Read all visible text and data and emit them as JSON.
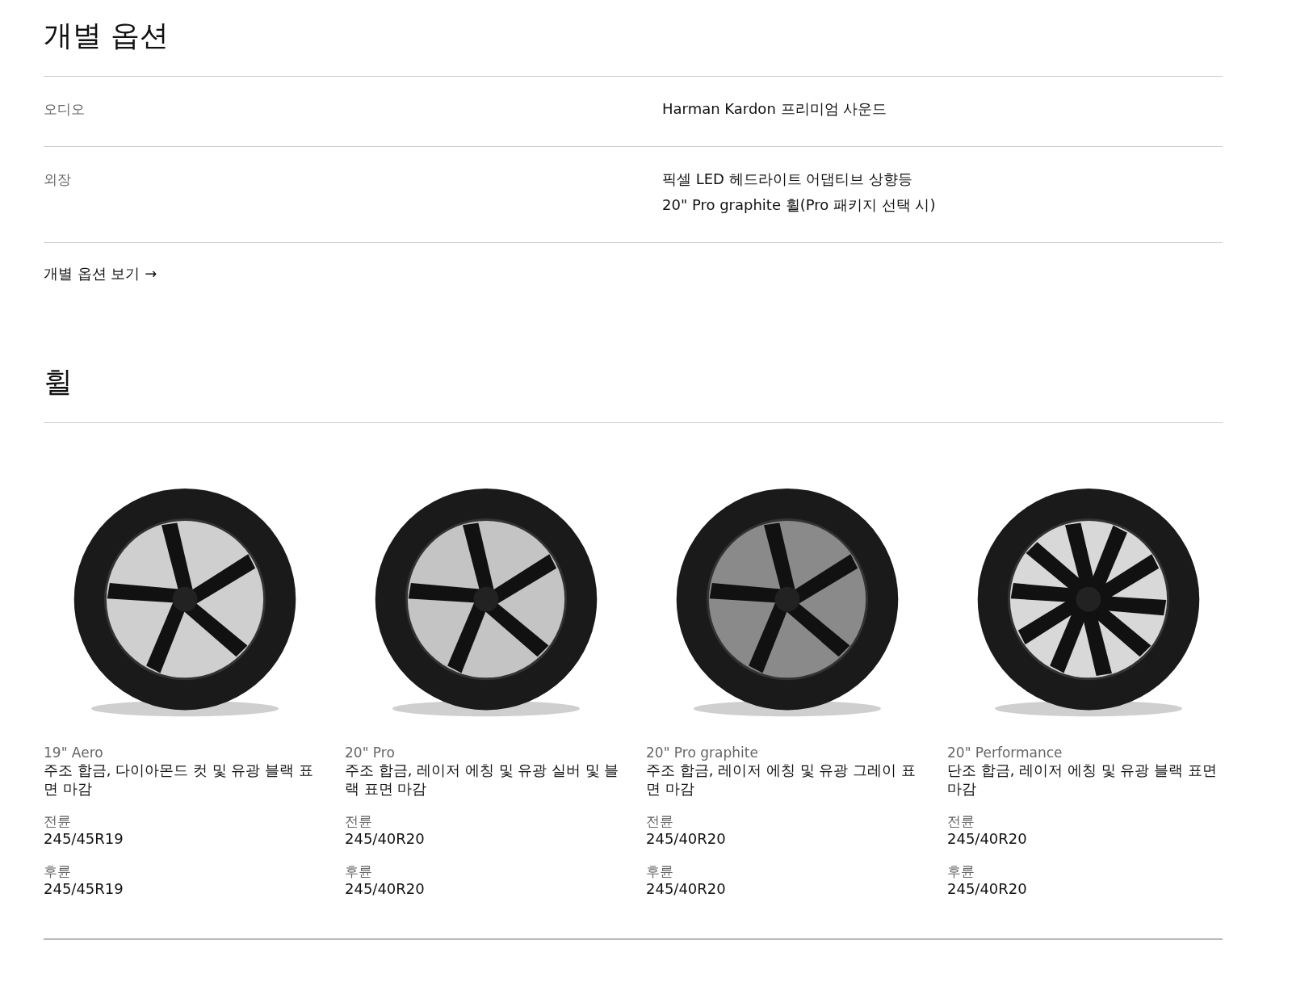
{
  "title": "개별 옵션",
  "options": [
    {
      "category": "오디오",
      "items": [
        "Harman Kardon 프리미엄 사운드"
      ]
    },
    {
      "category": "외장",
      "items": [
        "픽셀 LED 헤드라이트 어댑티브 상향등",
        "20\" Pro graphite 휠(Pro 패키지 선택 시)"
      ]
    }
  ],
  "options_link": "개별 옵션 보기 →",
  "wheels_title": "휠",
  "wheels": [
    {
      "name": "19\" Aero",
      "description": "주조 합금, 다이아몬드 컷 및 유광 블랙 표면 마감",
      "front_label": "전륜",
      "front": "245/45R19",
      "rear_label": "후륜",
      "rear": "245/45R19"
    },
    {
      "name": "20\" Pro",
      "description": "주조 합금, 레이저 에칭 및 유광 실버 및 블랙 표면 마감",
      "front_label": "전륜",
      "front": "245/40R20",
      "rear_label": "후륜",
      "rear": "245/40R20"
    },
    {
      "name": "20\" Pro graphite",
      "description": "주조 합금, 레이저 에칭 및 유광 그레이 표면 마감",
      "front_label": "전륜",
      "front": "245/40R20",
      "rear_label": "후륜",
      "rear": "245/40R20"
    },
    {
      "name": "20\" Performance",
      "description": "단조 합금, 레이저 에칭 및 유광 블랙 표면 마감",
      "front_label": "전륜",
      "front": "245/40R20",
      "rear_label": "후륜",
      "rear": "245/40R20"
    }
  ]
}
